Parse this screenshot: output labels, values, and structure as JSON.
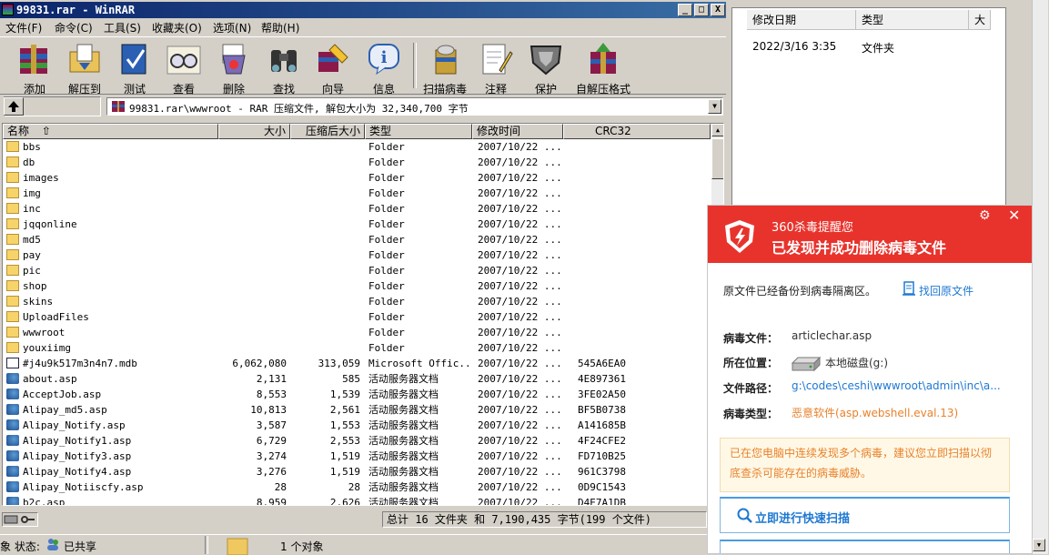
{
  "winrar": {
    "title": "99831.rar - WinRAR",
    "window_buttons": [
      "_",
      "□",
      "X"
    ],
    "menu": [
      "文件(F)",
      "命令(C)",
      "工具(S)",
      "收藏夹(O)",
      "选项(N)",
      "帮助(H)"
    ],
    "toolbar": [
      "添加",
      "解压到",
      "测试",
      "查看",
      "删除",
      "查找",
      "向导",
      "信息",
      "扫描病毒",
      "注释",
      "保护",
      "自解压格式"
    ],
    "path": "99831.rar\\wwwroot - RAR 压缩文件, 解包大小为 32,340,700 字节",
    "columns": [
      "名称",
      "大小",
      "压缩后大小",
      "类型",
      "修改时间",
      "CRC32"
    ],
    "sort_indicator": "⇧",
    "rows": [
      {
        "name": "bbs",
        "size": "",
        "packed": "",
        "type": "Folder",
        "mtime": "2007/10/22 ...",
        "crc": "",
        "icon": "folder"
      },
      {
        "name": "db",
        "size": "",
        "packed": "",
        "type": "Folder",
        "mtime": "2007/10/22 ...",
        "crc": "",
        "icon": "folder"
      },
      {
        "name": "images",
        "size": "",
        "packed": "",
        "type": "Folder",
        "mtime": "2007/10/22 ...",
        "crc": "",
        "icon": "folder"
      },
      {
        "name": "img",
        "size": "",
        "packed": "",
        "type": "Folder",
        "mtime": "2007/10/22 ...",
        "crc": "",
        "icon": "folder"
      },
      {
        "name": "inc",
        "size": "",
        "packed": "",
        "type": "Folder",
        "mtime": "2007/10/22 ...",
        "crc": "",
        "icon": "folder"
      },
      {
        "name": "jqqonline",
        "size": "",
        "packed": "",
        "type": "Folder",
        "mtime": "2007/10/22 ...",
        "crc": "",
        "icon": "folder"
      },
      {
        "name": "md5",
        "size": "",
        "packed": "",
        "type": "Folder",
        "mtime": "2007/10/22 ...",
        "crc": "",
        "icon": "folder"
      },
      {
        "name": "pay",
        "size": "",
        "packed": "",
        "type": "Folder",
        "mtime": "2007/10/22 ...",
        "crc": "",
        "icon": "folder"
      },
      {
        "name": "pic",
        "size": "",
        "packed": "",
        "type": "Folder",
        "mtime": "2007/10/22 ...",
        "crc": "",
        "icon": "folder"
      },
      {
        "name": "shop",
        "size": "",
        "packed": "",
        "type": "Folder",
        "mtime": "2007/10/22 ...",
        "crc": "",
        "icon": "folder"
      },
      {
        "name": "skins",
        "size": "",
        "packed": "",
        "type": "Folder",
        "mtime": "2007/10/22 ...",
        "crc": "",
        "icon": "folder"
      },
      {
        "name": "UploadFiles",
        "size": "",
        "packed": "",
        "type": "Folder",
        "mtime": "2007/10/22 ...",
        "crc": "",
        "icon": "folder"
      },
      {
        "name": "wwwroot",
        "size": "",
        "packed": "",
        "type": "Folder",
        "mtime": "2007/10/22 ...",
        "crc": "",
        "icon": "folder"
      },
      {
        "name": "youxiimg",
        "size": "",
        "packed": "",
        "type": "Folder",
        "mtime": "2007/10/22 ...",
        "crc": "",
        "icon": "folder"
      },
      {
        "name": "#j4u9k517m3n4n7.mdb",
        "size": "6,062,080",
        "packed": "313,059",
        "type": "Microsoft Offic...",
        "mtime": "2007/10/22 ...",
        "crc": "545A6EA0",
        "icon": "doc"
      },
      {
        "name": "about.asp",
        "size": "2,131",
        "packed": "585",
        "type": "活动服务器文档",
        "mtime": "2007/10/22 ...",
        "crc": "4E897361",
        "icon": "asp"
      },
      {
        "name": "AcceptJob.asp",
        "size": "8,553",
        "packed": "1,539",
        "type": "活动服务器文档",
        "mtime": "2007/10/22 ...",
        "crc": "3FE02A50",
        "icon": "asp"
      },
      {
        "name": "Alipay_md5.asp",
        "size": "10,813",
        "packed": "2,561",
        "type": "活动服务器文档",
        "mtime": "2007/10/22 ...",
        "crc": "BF5B0738",
        "icon": "asp"
      },
      {
        "name": "Alipay_Notify.asp",
        "size": "3,587",
        "packed": "1,553",
        "type": "活动服务器文档",
        "mtime": "2007/10/22 ...",
        "crc": "A141685B",
        "icon": "asp"
      },
      {
        "name": "Alipay_Notify1.asp",
        "size": "6,729",
        "packed": "2,553",
        "type": "活动服务器文档",
        "mtime": "2007/10/22 ...",
        "crc": "4F24CFE2",
        "icon": "asp"
      },
      {
        "name": "Alipay_Notify3.asp",
        "size": "3,274",
        "packed": "1,519",
        "type": "活动服务器文档",
        "mtime": "2007/10/22 ...",
        "crc": "FD710B25",
        "icon": "asp"
      },
      {
        "name": "Alipay_Notify4.asp",
        "size": "3,276",
        "packed": "1,519",
        "type": "活动服务器文档",
        "mtime": "2007/10/22 ...",
        "crc": "961C3798",
        "icon": "asp"
      },
      {
        "name": "Alipay_Notiiscfy.asp",
        "size": "28",
        "packed": "28",
        "type": "活动服务器文档",
        "mtime": "2007/10/22 ...",
        "crc": "0D9C1543",
        "icon": "asp"
      },
      {
        "name": "b2c.asp",
        "size": "8,959",
        "packed": "2,626",
        "type": "活动服务器文档",
        "mtime": "2007/10/22 ...",
        "crc": "D4E7A1DB",
        "icon": "asp"
      }
    ],
    "status_total": "总计 16 文件夹 和 7,190,435 字节(199 个文件)"
  },
  "explorer_status": {
    "left": "象 状态:",
    "shared": "已共享",
    "count": "1 个对象"
  },
  "background_window": {
    "columns": [
      "修改日期",
      "类型",
      "大小"
    ],
    "row": {
      "date": "2022/3/16 3:35",
      "type": "文件夹"
    }
  },
  "popup": {
    "brand": "360杀毒提醒您",
    "title": "已发现并成功删除病毒文件",
    "backup_note": "原文件已经备份到病毒隔离区。",
    "restore_link": "找回原文件",
    "virus_file_label": "病毒文件：",
    "virus_file": "articlechar.asp",
    "location_label": "所在位置：",
    "location": "本地磁盘(g:)",
    "path_label": "文件路径：",
    "path": "g:\\codes\\ceshi\\wwwroot\\admin\\inc\\a...",
    "type_label": "病毒类型：",
    "type": "恶意软件(asp.webshell.eval.13)",
    "warning": "已在您电脑中连续发现多个病毒，建议您立即扫描以彻底查杀可能存在的病毒威胁。",
    "scan_button": "立即进行快速扫描",
    "colors": {
      "header": "#e8332c",
      "link": "#1e78d2",
      "warning": "#e8822c",
      "type": "#e8822c"
    }
  }
}
